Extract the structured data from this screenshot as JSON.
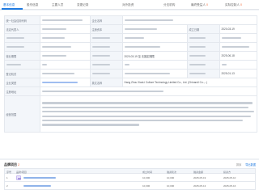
{
  "tabs": [
    {
      "label": "基本信息",
      "count": "",
      "active": true
    },
    {
      "label": "股东信息",
      "count": ""
    },
    {
      "label": "主要人员",
      "count": ""
    },
    {
      "label": "变更记录",
      "count": ""
    },
    {
      "label": "对外投资",
      "count": ""
    },
    {
      "label": "分支机构",
      "count": ""
    },
    {
      "label": "最终受益人",
      "count": "0"
    },
    {
      "label": "实际控制人",
      "count": "0"
    }
  ],
  "info": {
    "date_1": "2020-03-19",
    "date_2": "2025-06-18",
    "date_3": "2025-01-13",
    "range": "2020-03-19 至 无固定期限",
    "status": "存续",
    "company_en": "Hang Zhou XiaoLi Culture Technology Limited Co., Ltd. (Chinaroll Co.,...)",
    "row_labels": [
      "统一社会信用代码",
      "企业名称",
      "法定代表人",
      "注册资本",
      "成立日期",
      "营业期限",
      "登记机关",
      "企业类型",
      "英文名称",
      "注册地址",
      "经营范围"
    ]
  },
  "history": {
    "title": "品牌项目",
    "count": "2",
    "tool_1": "排序",
    "tool_2": "导出数据",
    "columns": [
      "序号",
      "品牌/项目",
      "",
      "成立时间",
      "融资轮次",
      "融资金额",
      "投资方"
    ],
    "rows": [
      {
        "index": "1",
        "amount": "10,000",
        "date": "2025-05-19",
        "time": "2025-05-10"
      },
      {
        "index": "2",
        "amount": "10,000",
        "date": "2025-05-13",
        "time": "2025-05-16"
      }
    ]
  }
}
